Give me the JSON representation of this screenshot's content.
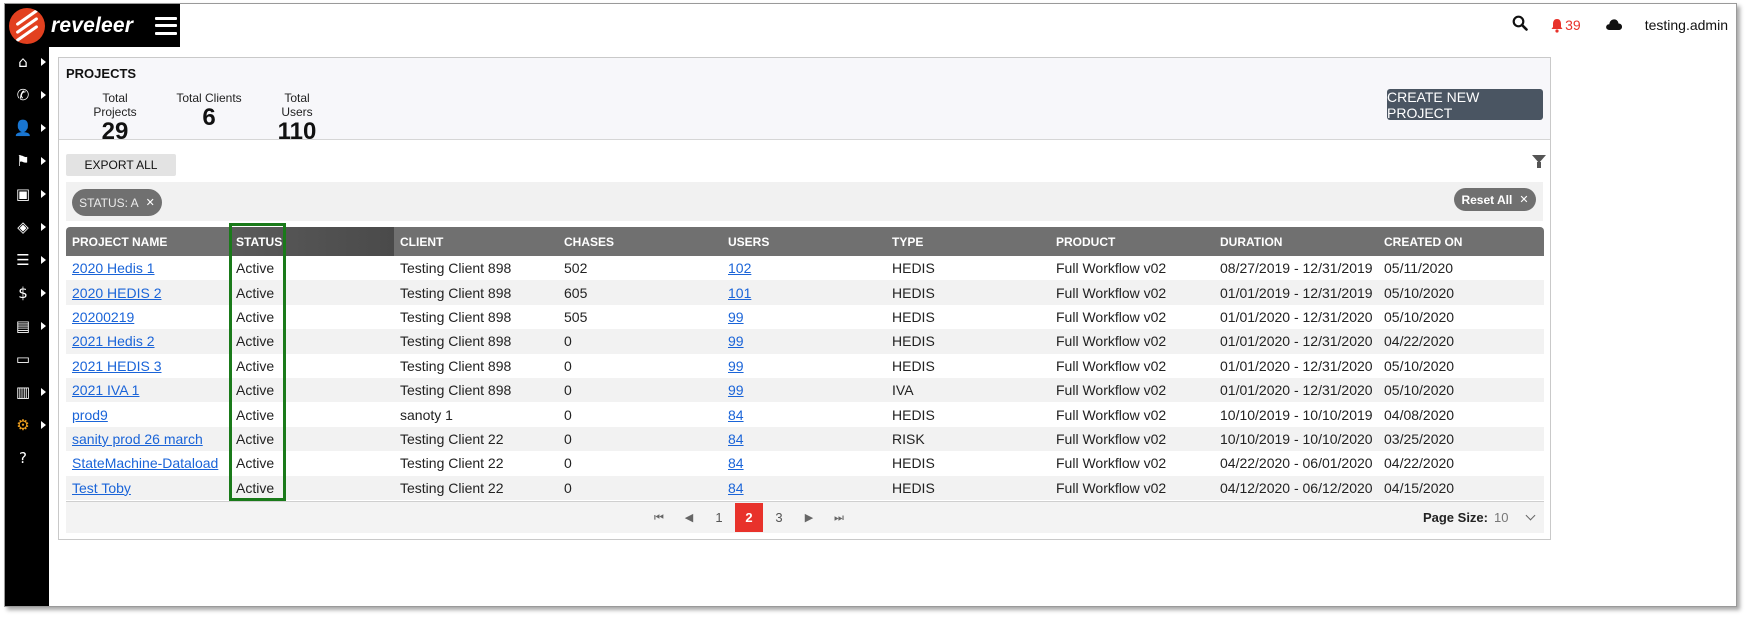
{
  "app": {
    "brand": "reveleer"
  },
  "topbar": {
    "notifications": "39",
    "username": "testing.admin"
  },
  "sidebar": {
    "items": [
      {
        "name": "home-icon",
        "glyph": "⌂"
      },
      {
        "name": "phone-icon",
        "glyph": "✆"
      },
      {
        "name": "user-icon",
        "glyph": "👤"
      },
      {
        "name": "flag-icon",
        "glyph": "⚑"
      },
      {
        "name": "briefcase-icon",
        "glyph": "▣"
      },
      {
        "name": "layers-icon",
        "glyph": "◈"
      },
      {
        "name": "tasks-icon",
        "glyph": "☰"
      },
      {
        "name": "dollar-icon",
        "glyph": "$"
      },
      {
        "name": "clipboard-icon",
        "glyph": "▤"
      },
      {
        "name": "document-icon",
        "glyph": "▭"
      },
      {
        "name": "chart-icon",
        "glyph": "▥"
      },
      {
        "name": "gear-icon",
        "glyph": "⚙"
      },
      {
        "name": "help-icon",
        "glyph": "?"
      }
    ]
  },
  "summary": {
    "title": "PROJECTS",
    "stats": [
      {
        "label": "Total Projects",
        "value": "29"
      },
      {
        "label": "Total Clients",
        "value": "6"
      },
      {
        "label": "Total Users",
        "value": "110"
      }
    ],
    "create_label": "CREATE NEW PROJECT"
  },
  "toolbar": {
    "export_label": "EXPORT ALL"
  },
  "filters": {
    "chip_label": "STATUS: A",
    "reset_label": "Reset All"
  },
  "table": {
    "columns": [
      "PROJECT NAME",
      "STATUS",
      "CLIENT",
      "CHASES",
      "USERS",
      "TYPE",
      "PRODUCT",
      "DURATION",
      "CREATED ON"
    ],
    "rows": [
      [
        "2020 Hedis 1",
        "Active",
        "Testing Client 898",
        "502",
        "102",
        "HEDIS",
        "Full Workflow v02",
        "08/27/2019 - 12/31/2019",
        "05/11/2020"
      ],
      [
        "2020 HEDIS 2",
        "Active",
        "Testing Client 898",
        "605",
        "101",
        "HEDIS",
        "Full Workflow v02",
        "01/01/2019 - 12/31/2019",
        "05/10/2020"
      ],
      [
        "20200219",
        "Active",
        "Testing Client 898",
        "505",
        "99",
        "HEDIS",
        "Full Workflow v02",
        "01/01/2020 - 12/31/2020",
        "05/10/2020"
      ],
      [
        "2021 Hedis 2",
        "Active",
        "Testing Client 898",
        "0",
        "99",
        "HEDIS",
        "Full Workflow v02",
        "01/01/2020 - 12/31/2020",
        "04/22/2020"
      ],
      [
        "2021 HEDIS 3",
        "Active",
        "Testing Client 898",
        "0",
        "99",
        "HEDIS",
        "Full Workflow v02",
        "01/01/2020 - 12/31/2020",
        "05/10/2020"
      ],
      [
        "2021 IVA 1",
        "Active",
        "Testing Client 898",
        "0",
        "99",
        "IVA",
        "Full Workflow v02",
        "01/01/2020 - 12/31/2020",
        "05/10/2020"
      ],
      [
        "prod9",
        "Active",
        "sanoty 1",
        "0",
        "84",
        "HEDIS",
        "Full Workflow v02",
        "10/10/2019 - 10/10/2019",
        "04/08/2020"
      ],
      [
        "sanity prod 26 march",
        "Active",
        "Testing Client 22",
        "0",
        "84",
        "RISK",
        "Full Workflow v02",
        "10/10/2019 - 10/10/2020",
        "03/25/2020"
      ],
      [
        "StateMachine-Dataload",
        "Active",
        "Testing Client 22",
        "0",
        "84",
        "HEDIS",
        "Full Workflow v02",
        "04/22/2020 - 06/01/2020",
        "04/22/2020"
      ],
      [
        "Test Toby",
        "Active",
        "Testing Client 22",
        "0",
        "84",
        "HEDIS",
        "Full Workflow v02",
        "04/12/2020 - 06/12/2020",
        "04/15/2020"
      ]
    ]
  },
  "pagination": {
    "pages": [
      "1",
      "2",
      "3"
    ],
    "current": "2",
    "page_size_label": "Page Size:",
    "page_size": "10"
  },
  "colors": {
    "accent": "#e8322b",
    "header": "#707070",
    "link": "#1a64d8",
    "highlight_box": "#1a7a1a"
  }
}
